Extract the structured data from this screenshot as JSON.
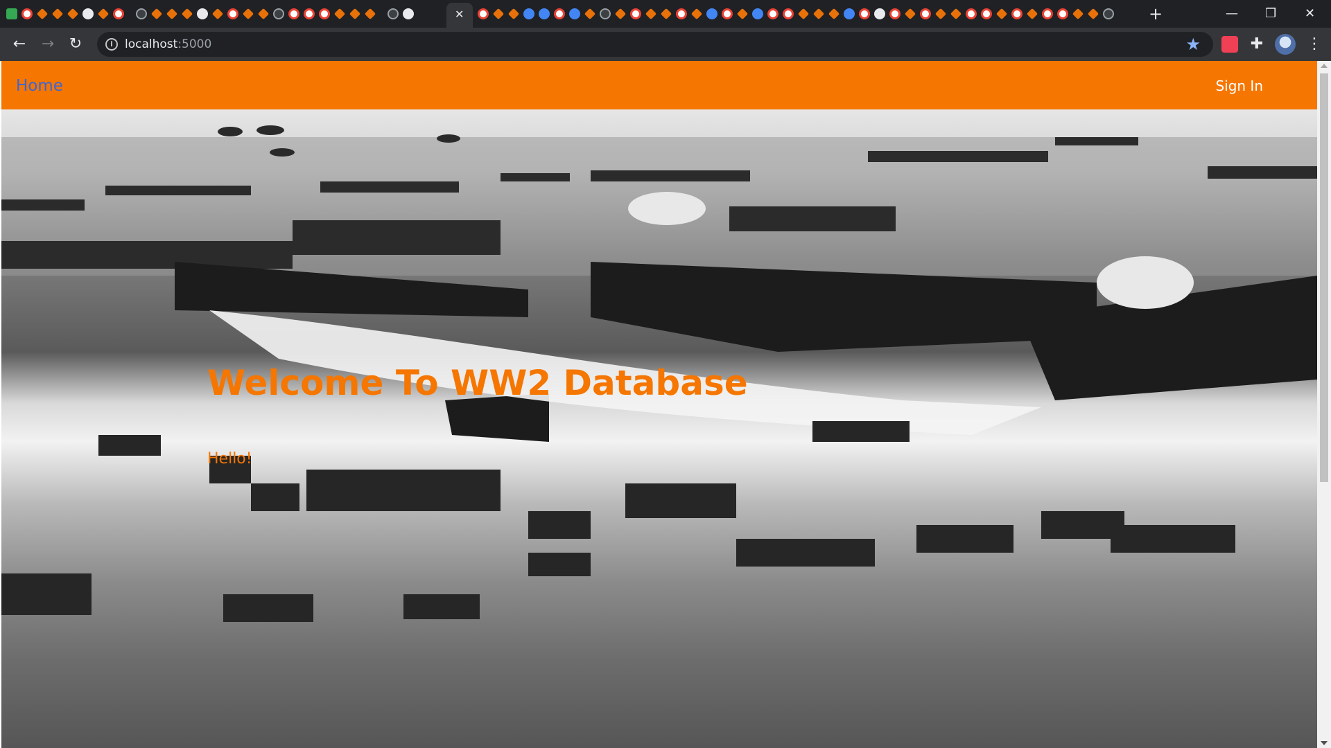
{
  "browser": {
    "url_host": "localhost",
    "url_port": ":5000",
    "tab_close_glyph": "✕",
    "new_tab_glyph": "+",
    "minimize_glyph": "—",
    "restore_glyph": "❐",
    "close_glyph": "✕",
    "icons": {
      "back": "back-arrow-icon",
      "forward": "forward-arrow-icon",
      "reload": "reload-icon",
      "site_info": "info-icon",
      "bookmark": "star-icon",
      "pocket": "pocket-icon",
      "extensions": "puzzle-icon",
      "profile": "avatar-icon",
      "menu": "kebab-menu-icon"
    }
  },
  "site": {
    "nav": {
      "home_label": "Home",
      "signin_label": "Sign In"
    },
    "hero": {
      "title": "Welcome To WW2 Database",
      "subtitle": "Hello!"
    },
    "colors": {
      "accent": "#f57600",
      "home_link": "#3c66d6",
      "signin": "#ffffff"
    }
  }
}
